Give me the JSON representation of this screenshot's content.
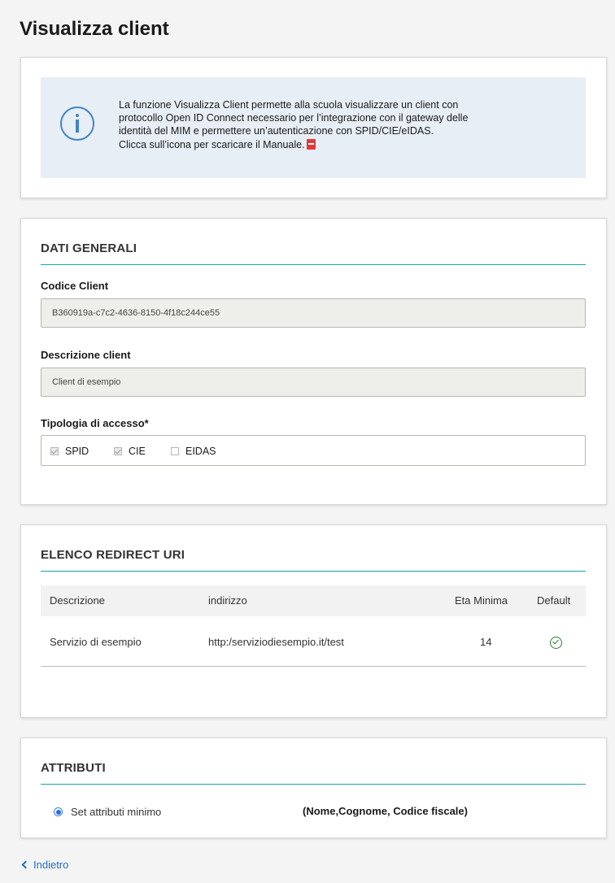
{
  "page": {
    "title": "Visualizza client",
    "back_label": "Indietro"
  },
  "info": {
    "line1": "La funzione Visualizza Client permette alla scuola visualizzare un client con",
    "line2": "protocollo Open ID Connect necessario per l’integrazione con il gateway delle",
    "line3": "identità del MIM e permettere un’autenticazione con SPID/CIE/eIDAS.",
    "line4": "Clicca sull’icona per scaricare il Manuale."
  },
  "general": {
    "section_title": "DATI GENERALI",
    "codice_label": "Codice Client",
    "codice_value": "B360919a-c7c2-4636-8150-4f18c244ce55",
    "descrizione_label": "Descrizione client",
    "descrizione_value": "Client di esempio",
    "tipologia_label": "Tipologia di accesso*",
    "access_types": [
      {
        "label": "SPID",
        "checked": true
      },
      {
        "label": "CIE",
        "checked": true
      },
      {
        "label": "EIDAS",
        "checked": false
      }
    ]
  },
  "redirect": {
    "section_title": "ELENCO REDIRECT URI",
    "columns": [
      "Descrizione",
      "indirizzo",
      "Eta Minima",
      "Default"
    ],
    "rows": [
      {
        "descrizione": "Servizio di esempio",
        "indirizzo": "http:/serviziodiesempio.it/test",
        "eta_minima": "14",
        "default": true
      }
    ]
  },
  "attributi": {
    "section_title": "ATTRIBUTI",
    "option_label": "Set attributi minimo",
    "option_detail": "(Nome,Cognome, Codice fiscale)"
  },
  "colors": {
    "accent_rule": "#1aa5a0",
    "info_blue": "#3f85c8",
    "link_blue": "#1f6fbf",
    "ok_green": "#2e7d32"
  },
  "icons": [
    "info-icon",
    "pdf-icon",
    "check-circle-icon",
    "chevron-left-icon"
  ]
}
